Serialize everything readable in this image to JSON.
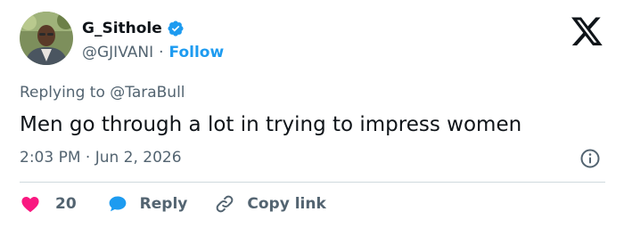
{
  "author": {
    "display_name": "G_Sithole",
    "handle": "@GJIVANI",
    "separator": "·",
    "follow_label": "Follow",
    "verified": true
  },
  "replying_to": {
    "prefix": "Replying to",
    "mention": "@TaraBull"
  },
  "tweet": {
    "text": "Men go through a lot in trying to impress women",
    "timestamp": "2:03 PM · Jun 2, 2026"
  },
  "actions": {
    "like_count": "20",
    "reply_label": "Reply",
    "copy_link_label": "Copy link"
  },
  "colors": {
    "like": "#f91880",
    "reply": "#1d9bf0",
    "follow": "#1d9bf0",
    "verified": "#1d9bf0",
    "text_primary": "#0f1419",
    "text_secondary": "#536471"
  },
  "icons": {
    "brand": "x-logo-icon",
    "verified": "verified-badge-icon",
    "info": "info-icon",
    "like": "heart-icon",
    "reply": "speech-bubble-icon",
    "copy": "link-icon"
  }
}
